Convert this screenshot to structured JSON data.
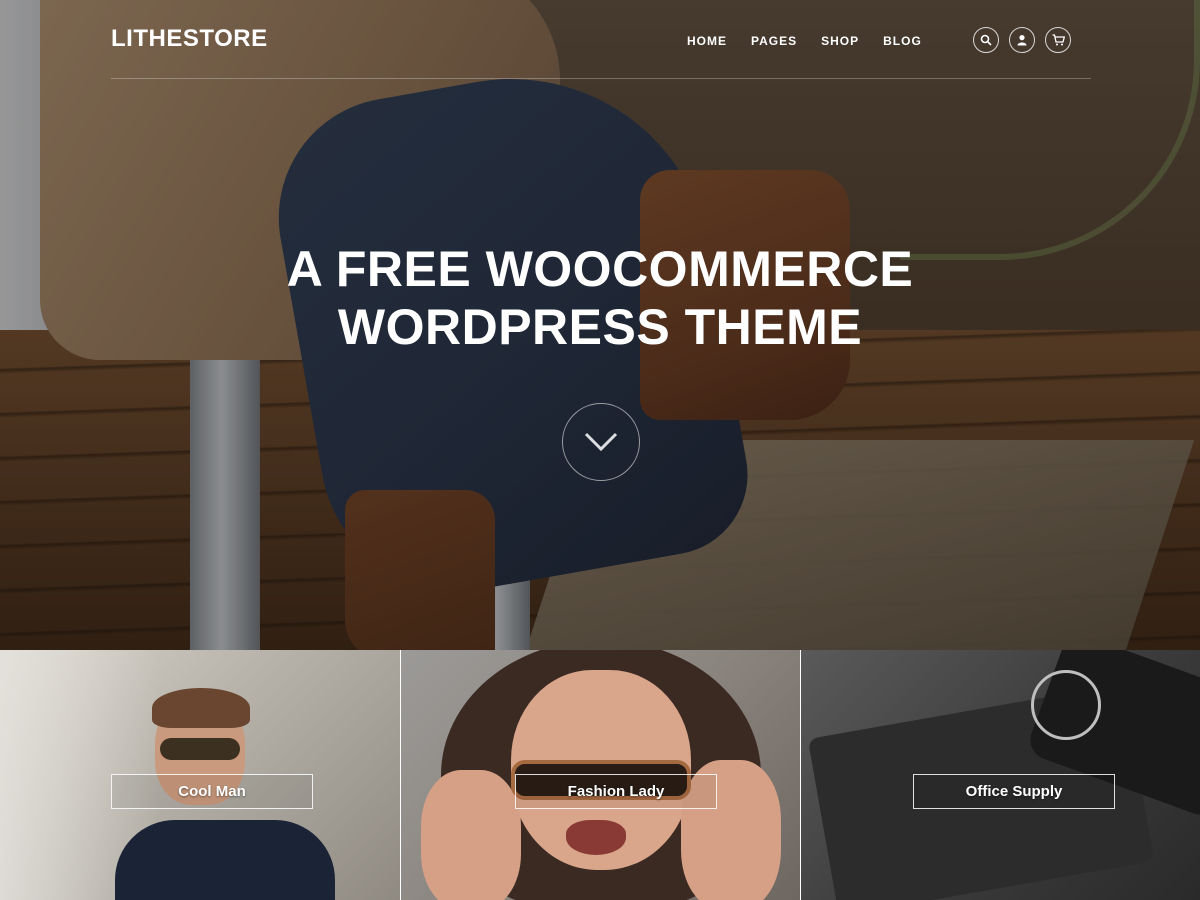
{
  "header": {
    "logo": "LITHESTORE",
    "nav": [
      {
        "label": "HOME"
      },
      {
        "label": "PAGES"
      },
      {
        "label": "SHOP"
      },
      {
        "label": "BLOG"
      }
    ],
    "icons": [
      "search-icon",
      "account-icon",
      "cart-icon"
    ]
  },
  "hero": {
    "headline_line1": "A FREE WOOCOMMERCE",
    "headline_line2": "WORDPRESS THEME",
    "scroll_icon": "chevron-down-icon"
  },
  "categories": [
    {
      "label": "Cool Man"
    },
    {
      "label": "Fashion Lady"
    },
    {
      "label": "Office Supply"
    }
  ]
}
